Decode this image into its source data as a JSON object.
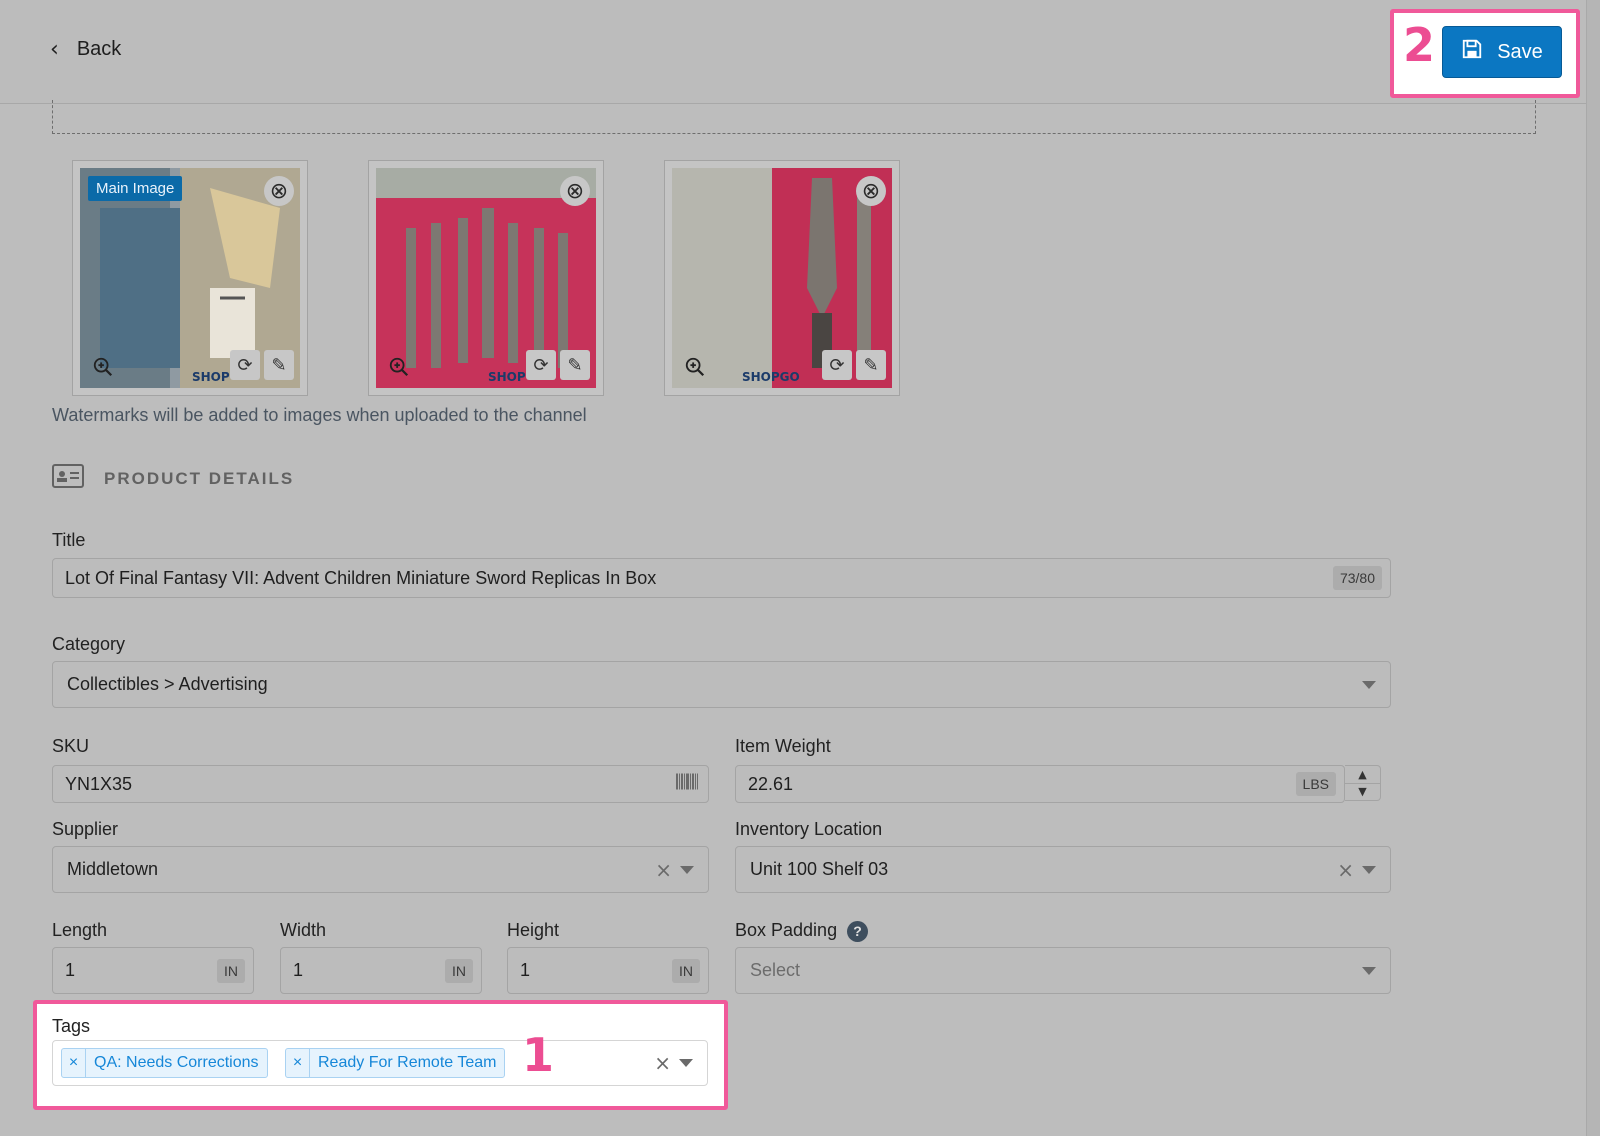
{
  "header": {
    "back_label": "Back",
    "save_label": "Save",
    "save_callout": "2"
  },
  "images": {
    "main_badge": "Main Image",
    "watermark_brand": "SHOP",
    "watermark_brand_full": "SHOPGO",
    "note": "Watermarks will be added to images when uploaded to the channel"
  },
  "section": {
    "title": "PRODUCT DETAILS"
  },
  "form": {
    "title_label": "Title",
    "title_value": "Lot Of Final Fantasy VII: Advent Children Miniature Sword Replicas In Box",
    "title_count": "73/80",
    "category_label": "Category",
    "category_value": "Collectibles > Advertising",
    "sku_label": "SKU",
    "sku_value": "YN1X35",
    "weight_label": "Item Weight",
    "weight_value": "22.61",
    "weight_unit": "LBS",
    "supplier_label": "Supplier",
    "supplier_value": "Middletown",
    "location_label": "Inventory Location",
    "location_value": "Unit 100 Shelf 03",
    "length_label": "Length",
    "length_value": "1",
    "width_label": "Width",
    "width_value": "1",
    "height_label": "Height",
    "height_value": "1",
    "dim_unit": "IN",
    "padding_label": "Box Padding",
    "padding_placeholder": "Select",
    "tags_label": "Tags",
    "tags": [
      "QA: Needs Corrections",
      "Ready For Remote Team"
    ],
    "tags_callout": "1"
  },
  "colors": {
    "accent": "#0b77c2",
    "callout": "#f0599a",
    "tag_text": "#1687d8"
  }
}
